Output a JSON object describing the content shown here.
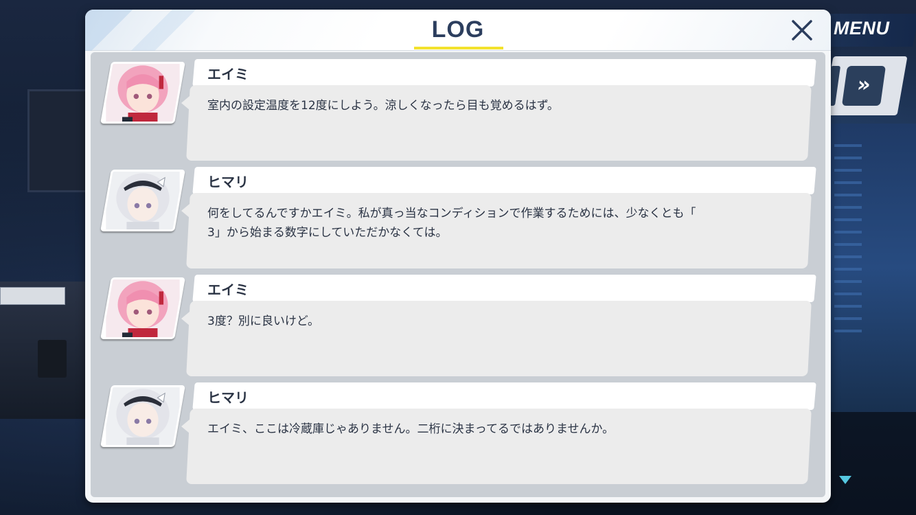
{
  "hud": {
    "menu_label": "MENU",
    "fast_forward_icon": "double-chevron-right-icon"
  },
  "log": {
    "title": "LOG",
    "close_icon": "close-icon",
    "accent_color": "#f3e22c",
    "entries": [
      {
        "speaker": "エイミ",
        "portrait": "eimi-portrait",
        "lines": [
          "室内の設定温度を12度にしよう。涼しくなったら目も覚めるはず。"
        ]
      },
      {
        "speaker": "ヒマリ",
        "portrait": "himari-portrait",
        "lines": [
          "何をしてるんですかエイミ。私が真っ当なコンディションで作業するためには、少なくとも「",
          "3」から始まる数字にしていただかなくては。"
        ]
      },
      {
        "speaker": "エイミ",
        "portrait": "eimi-portrait",
        "lines": [
          "3度？別に良いけど。"
        ]
      },
      {
        "speaker": "ヒマリ",
        "portrait": "himari-portrait",
        "lines": [
          "エイミ、ここは冷蔵庫じゃありません。二桁に決まってるではありませんか。"
        ]
      }
    ]
  }
}
